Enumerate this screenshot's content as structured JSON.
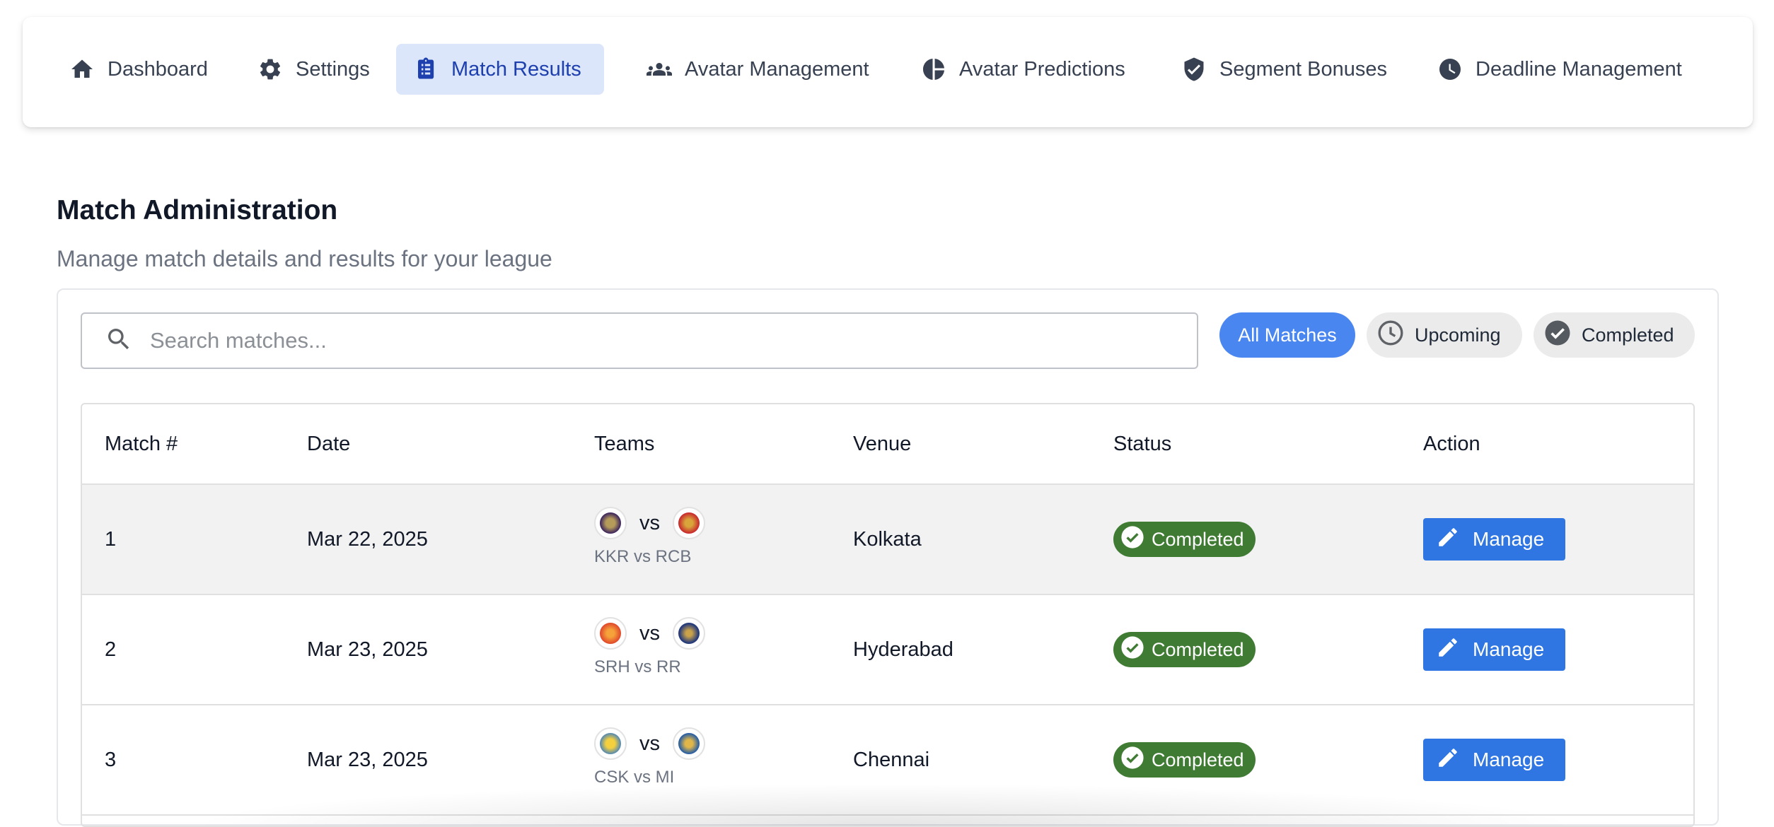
{
  "nav": {
    "items": [
      {
        "label": "Dashboard",
        "icon": "home-icon"
      },
      {
        "label": "Settings",
        "icon": "gear-icon"
      },
      {
        "label": "Match Results",
        "icon": "clipboard-list-icon",
        "active": true
      },
      {
        "label": "Avatar Management",
        "icon": "people-icon"
      },
      {
        "label": "Avatar Predictions",
        "icon": "pie-chart-icon"
      },
      {
        "label": "Segment Bonuses",
        "icon": "verified-badge-icon"
      },
      {
        "label": "Deadline Management",
        "icon": "clock-icon"
      }
    ]
  },
  "header": {
    "title": "Match Administration",
    "subtitle": "Manage match details and results for your league"
  },
  "search": {
    "placeholder": "Search matches...",
    "value": ""
  },
  "filters": {
    "all": "All Matches",
    "upcoming": "Upcoming",
    "completed": "Completed",
    "selected": "All Matches"
  },
  "table": {
    "columns": [
      "Match #",
      "Date",
      "Teams",
      "Venue",
      "Status",
      "Action"
    ],
    "rows": [
      {
        "match": "1",
        "date": "Mar 22, 2025",
        "vs": "vs",
        "teams": "KKR vs RCB",
        "venue": "Kolkata",
        "status": "Completed",
        "action": "Manage"
      },
      {
        "match": "2",
        "date": "Mar 23, 2025",
        "vs": "vs",
        "teams": "SRH vs RR",
        "venue": "Hyderabad",
        "status": "Completed",
        "action": "Manage"
      },
      {
        "match": "3",
        "date": "Mar 23, 2025",
        "vs": "vs",
        "teams": "CSK vs MI",
        "venue": "Chennai",
        "status": "Completed",
        "action": "Manage"
      }
    ]
  },
  "colors": {
    "accent": "#2f76e3",
    "active_nav_bg": "#dbe6fb",
    "status_completed": "#3f7b33",
    "chip_all": "#4a86f0"
  }
}
